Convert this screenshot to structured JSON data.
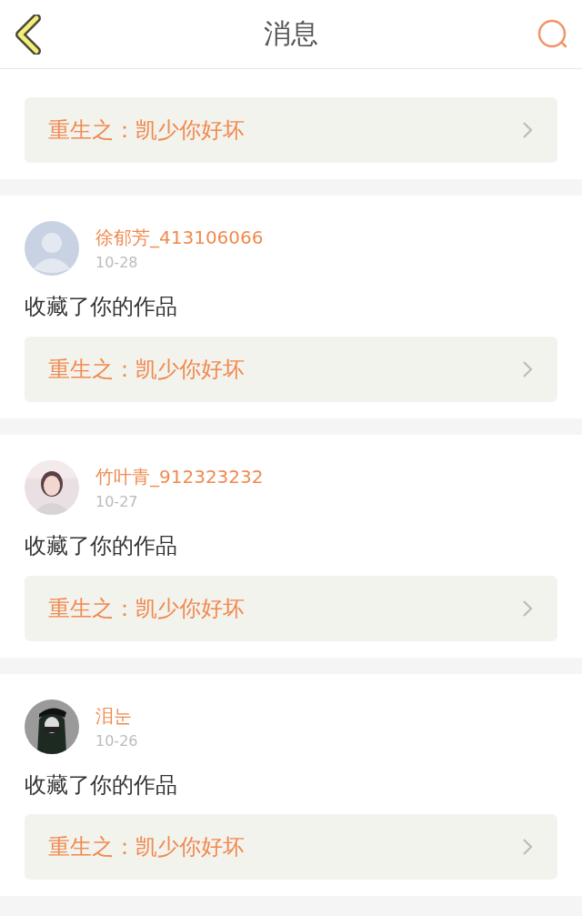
{
  "header": {
    "title": "消息"
  },
  "messages": [
    {
      "work": "重生之：凯少你好坏"
    },
    {
      "user": "徐郁芳_413106066",
      "date": "10-28",
      "avatar": {
        "kind": "default"
      },
      "action": "收藏了你的作品",
      "work": "重生之：凯少你好坏"
    },
    {
      "user": "竹叶青_912323232",
      "date": "10-27",
      "action": "收藏了你的作品",
      "work": "重生之：凯少你好坏"
    },
    {
      "user": "泪눈",
      "date": "10-26",
      "action": "收藏了你的作品",
      "work": "重生之：凯少你好坏"
    }
  ]
}
